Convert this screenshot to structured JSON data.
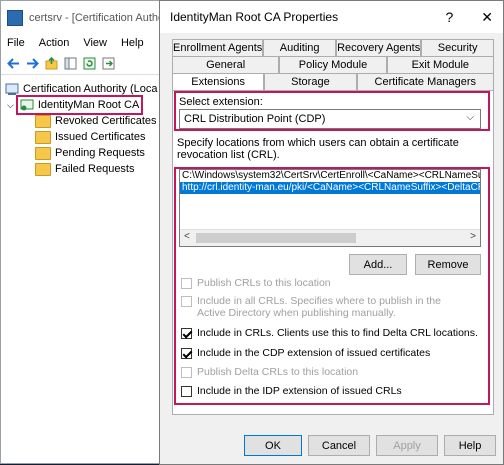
{
  "mmc": {
    "title": "certsrv - [Certification Autho",
    "menu": [
      "File",
      "Action",
      "View",
      "Help"
    ],
    "tree": [
      {
        "label": "Certification Authority (Loca",
        "indent": 0,
        "icon": "ca"
      },
      {
        "label": "IdentityMan Root CA",
        "indent": 1,
        "icon": "ca"
      },
      {
        "label": "Revoked Certificates",
        "indent": 2,
        "icon": "folder"
      },
      {
        "label": "Issued Certificates",
        "indent": 2,
        "icon": "folder"
      },
      {
        "label": "Pending Requests",
        "indent": 2,
        "icon": "folder"
      },
      {
        "label": "Failed Requests",
        "indent": 2,
        "icon": "folder"
      }
    ]
  },
  "dialog": {
    "title": "IdentityMan Root CA Properties",
    "help_glyph": "?",
    "close_glyph": "✕",
    "tabs_row1": [
      "Enrollment Agents",
      "Auditing",
      "Recovery Agents",
      "Security"
    ],
    "tabs_row2": [
      "General",
      "Policy Module",
      "Exit Module"
    ],
    "tabs_row3": [
      "Extensions",
      "Storage",
      "Certificate Managers"
    ],
    "active_tab": "Extensions",
    "select_extension_label": "Select extension:",
    "selected_extension": "CRL Distribution Point (CDP)",
    "description": "Specify locations from which users can obtain a certificate revocation list (CRL).",
    "locations": [
      "C:\\Windows\\system32\\CertSrv\\CertEnroll\\<CaName><CRLNameSuffix><",
      "http://crl.identity-man.eu/pki/<CaName><CRLNameSuffix><DeltaCRLAllo"
    ],
    "selected_location_index": 1,
    "add_button": "Add...",
    "remove_button": "Remove",
    "options": [
      {
        "label": "Publish CRLs to this location",
        "checked": false,
        "disabled": true
      },
      {
        "label": "Include in all CRLs. Specifies where to publish in the Active Directory when publishing manually.",
        "checked": false,
        "disabled": true
      },
      {
        "label": "Include in CRLs. Clients use this to find Delta CRL locations.",
        "checked": true,
        "disabled": false
      },
      {
        "label": "Include in the CDP extension of issued certificates",
        "checked": true,
        "disabled": false
      },
      {
        "label": "Publish Delta CRLs to this location",
        "checked": false,
        "disabled": true
      },
      {
        "label": "Include in the IDP extension of issued CRLs",
        "checked": false,
        "disabled": false
      }
    ],
    "buttons": {
      "ok": "OK",
      "cancel": "Cancel",
      "apply": "Apply",
      "help": "Help"
    }
  },
  "colors": {
    "highlight": "#c2185b",
    "selection": "#0078d7"
  }
}
